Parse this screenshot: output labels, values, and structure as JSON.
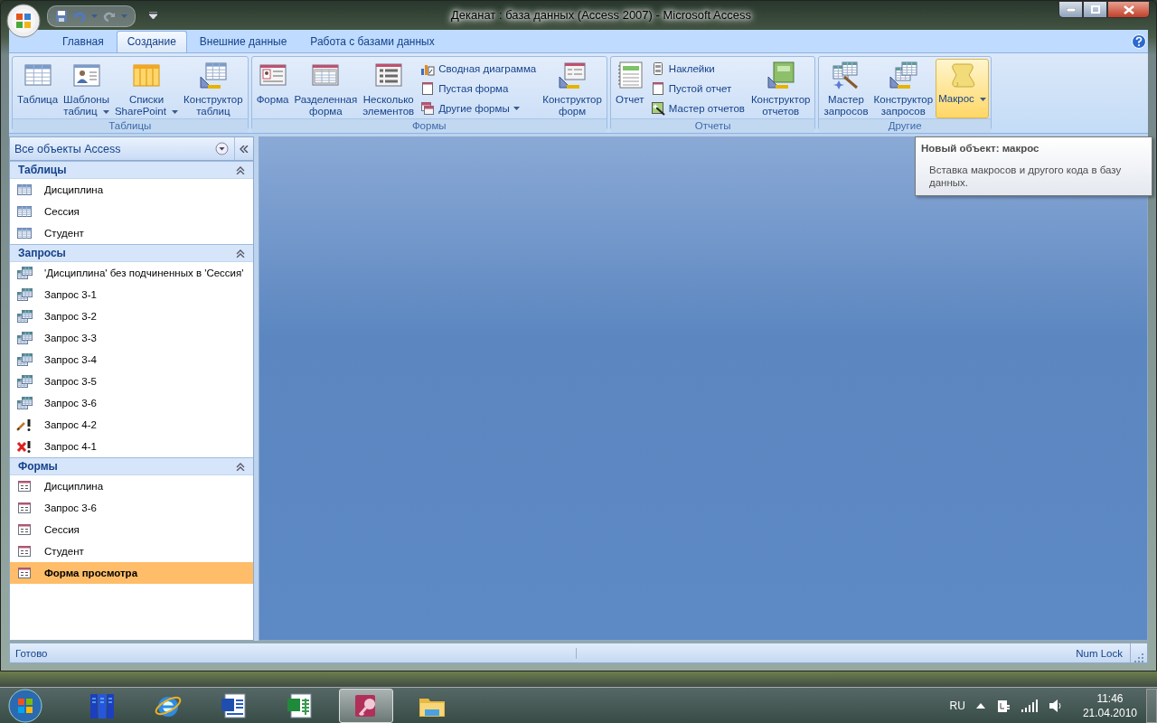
{
  "window": {
    "title": "Деканат : база данных (Access 2007)  -  Microsoft Access"
  },
  "ribbon": {
    "tabs": [
      {
        "label": "Главная",
        "selected": false
      },
      {
        "label": "Создание",
        "selected": true
      },
      {
        "label": "Внешние данные",
        "selected": false
      },
      {
        "label": "Работа с базами данных",
        "selected": false
      }
    ],
    "groups": [
      {
        "label": "Таблицы",
        "items": [
          {
            "kind": "large",
            "label": "Таблица",
            "dropdown": false,
            "hovered": false
          },
          {
            "kind": "large",
            "label": "Шаблоны таблиц",
            "dropdown": true,
            "hovered": false
          },
          {
            "kind": "large",
            "label": "Списки SharePoint",
            "dropdown": true,
            "hovered": false
          },
          {
            "kind": "large",
            "label": "Конструктор таблиц",
            "dropdown": false,
            "hovered": false
          }
        ]
      },
      {
        "label": "Формы",
        "items": [
          {
            "kind": "large",
            "label": "Форма",
            "dropdown": false,
            "hovered": false
          },
          {
            "kind": "large",
            "label": "Разделенная форма",
            "dropdown": false,
            "hovered": false
          },
          {
            "kind": "large",
            "label": "Несколько элементов",
            "dropdown": false,
            "hovered": false
          },
          {
            "kind": "stack",
            "buttons": [
              {
                "label": "Сводная диаграмма",
                "dropdown": false
              },
              {
                "label": "Пустая форма",
                "dropdown": false
              },
              {
                "label": "Другие формы",
                "dropdown": true
              }
            ]
          },
          {
            "kind": "large",
            "label": "Конструктор форм",
            "dropdown": false,
            "hovered": false
          }
        ]
      },
      {
        "label": "Отчеты",
        "items": [
          {
            "kind": "large",
            "label": "Отчет",
            "dropdown": false,
            "hovered": false
          },
          {
            "kind": "stack",
            "buttons": [
              {
                "label": "Наклейки",
                "dropdown": false
              },
              {
                "label": "Пустой отчет",
                "dropdown": false
              },
              {
                "label": "Мастер отчетов",
                "dropdown": false
              }
            ]
          },
          {
            "kind": "large",
            "label": "Конструктор отчетов",
            "dropdown": false,
            "hovered": false
          }
        ]
      },
      {
        "label": "Другие",
        "items": [
          {
            "kind": "large",
            "label": "Мастер запросов",
            "dropdown": false,
            "hovered": false
          },
          {
            "kind": "large",
            "label": "Конструктор запросов",
            "dropdown": false,
            "hovered": false
          },
          {
            "kind": "large",
            "label": "Макрос",
            "dropdown": true,
            "hovered": true
          }
        ]
      }
    ]
  },
  "tooltip": {
    "title": "Новый объект: макрос",
    "text": "Вставка макросов и другого кода в базу данных."
  },
  "nav_pane": {
    "title": "Все объекты Access",
    "groups": [
      {
        "label": "Таблицы",
        "expanded": true,
        "items": [
          {
            "label": "Дисциплина",
            "kind": "table",
            "selected": false
          },
          {
            "label": "Сессия",
            "kind": "table",
            "selected": false
          },
          {
            "label": "Студент",
            "kind": "table",
            "selected": false
          }
        ]
      },
      {
        "label": "Запросы",
        "expanded": true,
        "items": [
          {
            "label": "'Дисциплина' без подчиненных в 'Сессия'",
            "kind": "query",
            "selected": false
          },
          {
            "label": "Запрос 3-1",
            "kind": "query",
            "selected": false
          },
          {
            "label": "Запрос 3-2",
            "kind": "query",
            "selected": false
          },
          {
            "label": "Запрос 3-3",
            "kind": "query",
            "selected": false
          },
          {
            "label": "Запрос 3-4",
            "kind": "query",
            "selected": false
          },
          {
            "label": "Запрос 3-5",
            "kind": "query",
            "selected": false
          },
          {
            "label": "Запрос 3-6",
            "kind": "query",
            "selected": false
          },
          {
            "label": "Запрос 4-2",
            "kind": "update-query",
            "selected": false
          },
          {
            "label": "Запрос 4-1",
            "kind": "delete-query",
            "selected": false
          }
        ]
      },
      {
        "label": "Формы",
        "expanded": true,
        "items": [
          {
            "label": "Дисциплина",
            "kind": "form",
            "selected": false
          },
          {
            "label": "Запрос 3-6",
            "kind": "form",
            "selected": false
          },
          {
            "label": "Сессия",
            "kind": "form",
            "selected": false
          },
          {
            "label": "Студент",
            "kind": "form",
            "selected": false
          },
          {
            "label": "Форма просмотра",
            "kind": "form",
            "selected": true
          }
        ]
      }
    ]
  },
  "status_bar": {
    "left": "Готово",
    "right": "Num Lock"
  },
  "taskbar": {
    "apps": [
      {
        "kind": "library",
        "active": false
      },
      {
        "kind": "browser",
        "active": false
      },
      {
        "kind": "word",
        "active": false
      },
      {
        "kind": "excel",
        "active": false
      },
      {
        "kind": "access",
        "active": true
      },
      {
        "kind": "folder",
        "active": false
      }
    ],
    "language": "RU",
    "time": "11:46",
    "date": "21.04.2010"
  }
}
